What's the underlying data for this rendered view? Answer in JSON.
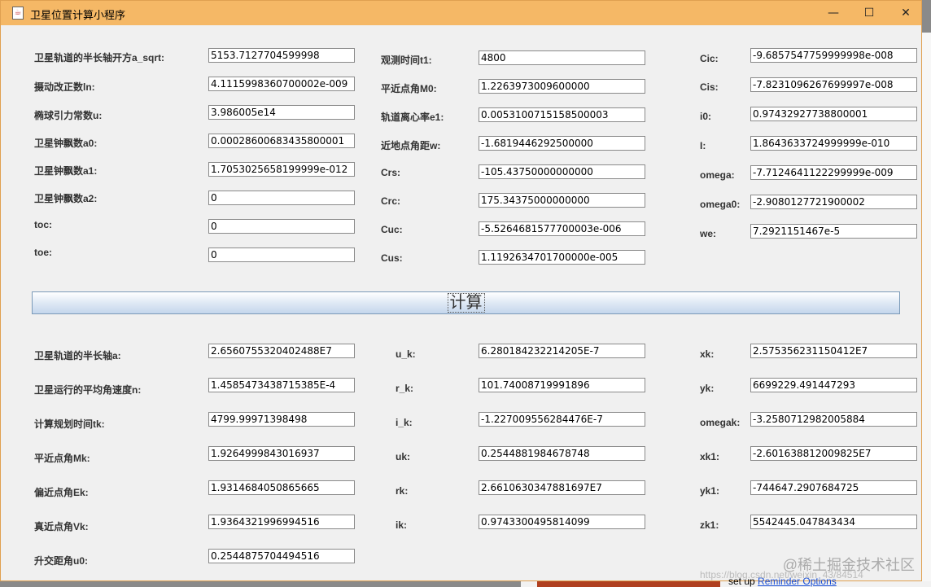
{
  "window": {
    "title": "卫星位置计算小程序"
  },
  "window_controls": {
    "minimize": "—",
    "maximize": "☐",
    "close": "✕"
  },
  "inputs": {
    "col1": [
      {
        "label": "卫星轨道的半长轴开方a_sqrt:",
        "value": "5153.7127704599998"
      },
      {
        "label": "摄动改正数ln:",
        "value": "4.1115998360700002e-009"
      },
      {
        "label": "椭球引力常数u:",
        "value": "3.986005e14"
      },
      {
        "label": "卫星钟飘数a0:",
        "value": "0.00028600683435800001"
      },
      {
        "label": "卫星钟飘数a1:",
        "value": "1.7053025658199999e-012"
      },
      {
        "label": "卫星钟飘数a2:",
        "value": "0"
      },
      {
        "label": "toc:",
        "value": "0"
      },
      {
        "label": "toe:",
        "value": "0"
      }
    ],
    "col2": [
      {
        "label": "观测时间t1:",
        "value": "4800"
      },
      {
        "label": "平近点角M0:",
        "value": "1.2263973009600000"
      },
      {
        "label": "轨道离心率e1:",
        "value": "0.0053100715158500003"
      },
      {
        "label": "近地点角距w:",
        "value": "-1.6819446292500000"
      },
      {
        "label": "Crs:",
        "value": "-105.43750000000000"
      },
      {
        "label": "Crc:",
        "value": "175.34375000000000"
      },
      {
        "label": "Cuc:",
        "value": "-5.5264681577700003e-006"
      },
      {
        "label": "Cus:",
        "value": "1.1192634701700000e-005"
      }
    ],
    "col3": [
      {
        "label": "Cic:",
        "value": "-9.6857547759999998e-008"
      },
      {
        "label": "Cis:",
        "value": "-7.8231096267699997e-008"
      },
      {
        "label": "i0:",
        "value": "0.97432927738800001"
      },
      {
        "label": "I:",
        "value": "1.8643633724999999e-010"
      },
      {
        "label": "omega:",
        "value": "-7.7124641122299999e-009"
      },
      {
        "label": "omega0:",
        "value": "-2.9080127721900002"
      },
      {
        "label": "we:",
        "value": "7.2921151467e-5"
      }
    ]
  },
  "calculate_button": {
    "label": "计算"
  },
  "outputs": {
    "col1": [
      {
        "label": "卫星轨道的半长轴a:",
        "value": "2.6560755320402488E7"
      },
      {
        "label": "卫星运行的平均角速度n:",
        "value": "1.4585473438715385E-4"
      },
      {
        "label": "计算规划时间tk:",
        "value": "4799.99971398498"
      },
      {
        "label": "平近点角Mk:",
        "value": "1.9264999843016937"
      },
      {
        "label": "偏近点角Ek:",
        "value": "1.9314684050865665"
      },
      {
        "label": "真近点角Vk:",
        "value": "1.9364321996994516"
      },
      {
        "label": "升交距角u0:",
        "value": "0.2544875704494516"
      }
    ],
    "col2": [
      {
        "label": "u_k:",
        "value": "6.280184232214205E-7"
      },
      {
        "label": "r_k:",
        "value": "101.74008719991896"
      },
      {
        "label": "i_k:",
        "value": "-1.227009556284476E-7"
      },
      {
        "label": "uk:",
        "value": "0.2544881984678748"
      },
      {
        "label": "rk:",
        "value": "2.6610630347881697E7"
      },
      {
        "label": "ik:",
        "value": "0.9743300495814099"
      }
    ],
    "col3": [
      {
        "label": "xk:",
        "value": "2.575356231150412E7"
      },
      {
        "label": "yk:",
        "value": "6699229.491447293"
      },
      {
        "label": "omegak:",
        "value": "-3.2580712982005884"
      },
      {
        "label": "xk1:",
        "value": "-2.601638812009825E7"
      },
      {
        "label": "yk1:",
        "value": "-744647.2907684725"
      },
      {
        "label": "zk1:",
        "value": "5542445.047843434"
      }
    ]
  },
  "watermark": "@稀土掘金技术社区",
  "watermark_url": "https://blog.csdn.net/weixin_43/84514",
  "background_text": {
    "prefix": "set up ",
    "link": "Reminder Options"
  }
}
